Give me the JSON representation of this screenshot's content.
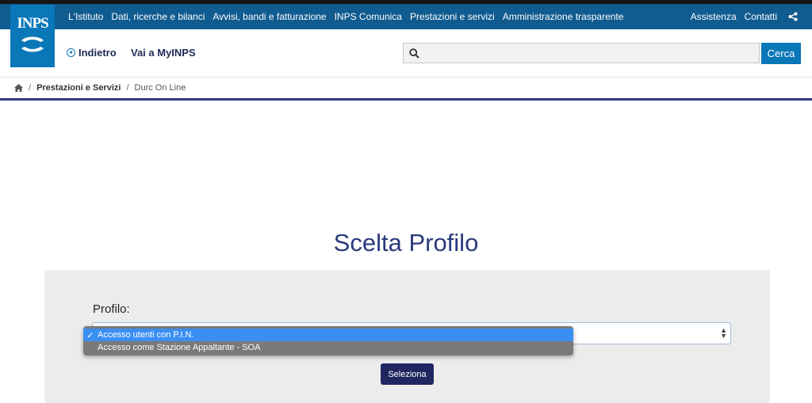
{
  "logo": {
    "text": "INPS"
  },
  "topnav": {
    "items": [
      "L'Istituto",
      "Dati, ricerche e bilanci",
      "Avvisi, bandi e fatturazione",
      "INPS Comunica",
      "Prestazioni e servizi",
      "Amministrazione trasparente"
    ],
    "right": [
      "Assistenza",
      "Contatti"
    ]
  },
  "subheader": {
    "back_label": "Indietro",
    "myinps_label": "Vai a MyINPS",
    "search_value": "",
    "search_button": "Cerca"
  },
  "breadcrumb": {
    "items": [
      "Prestazioni e Servizi",
      "Durc On Line"
    ]
  },
  "main": {
    "title": "Scelta Profilo",
    "field_label": "Profilo:",
    "options": [
      "Accesso utenti con P.I.N.",
      "Accesso come Stazione Appaltante - SOA"
    ],
    "selected_index": 0,
    "submit_label": "Seleziona"
  },
  "colors": {
    "topbar": "#105b8f",
    "brand_blue": "#0a77b8",
    "title": "#2b3a7d",
    "button": "#1f2660",
    "dropdown_highlight": "#3b8ff3"
  },
  "icons": [
    "inps-logo",
    "share-icon",
    "back-circle-icon",
    "search-icon",
    "home-icon",
    "checkmark-icon",
    "select-arrows-icon"
  ]
}
